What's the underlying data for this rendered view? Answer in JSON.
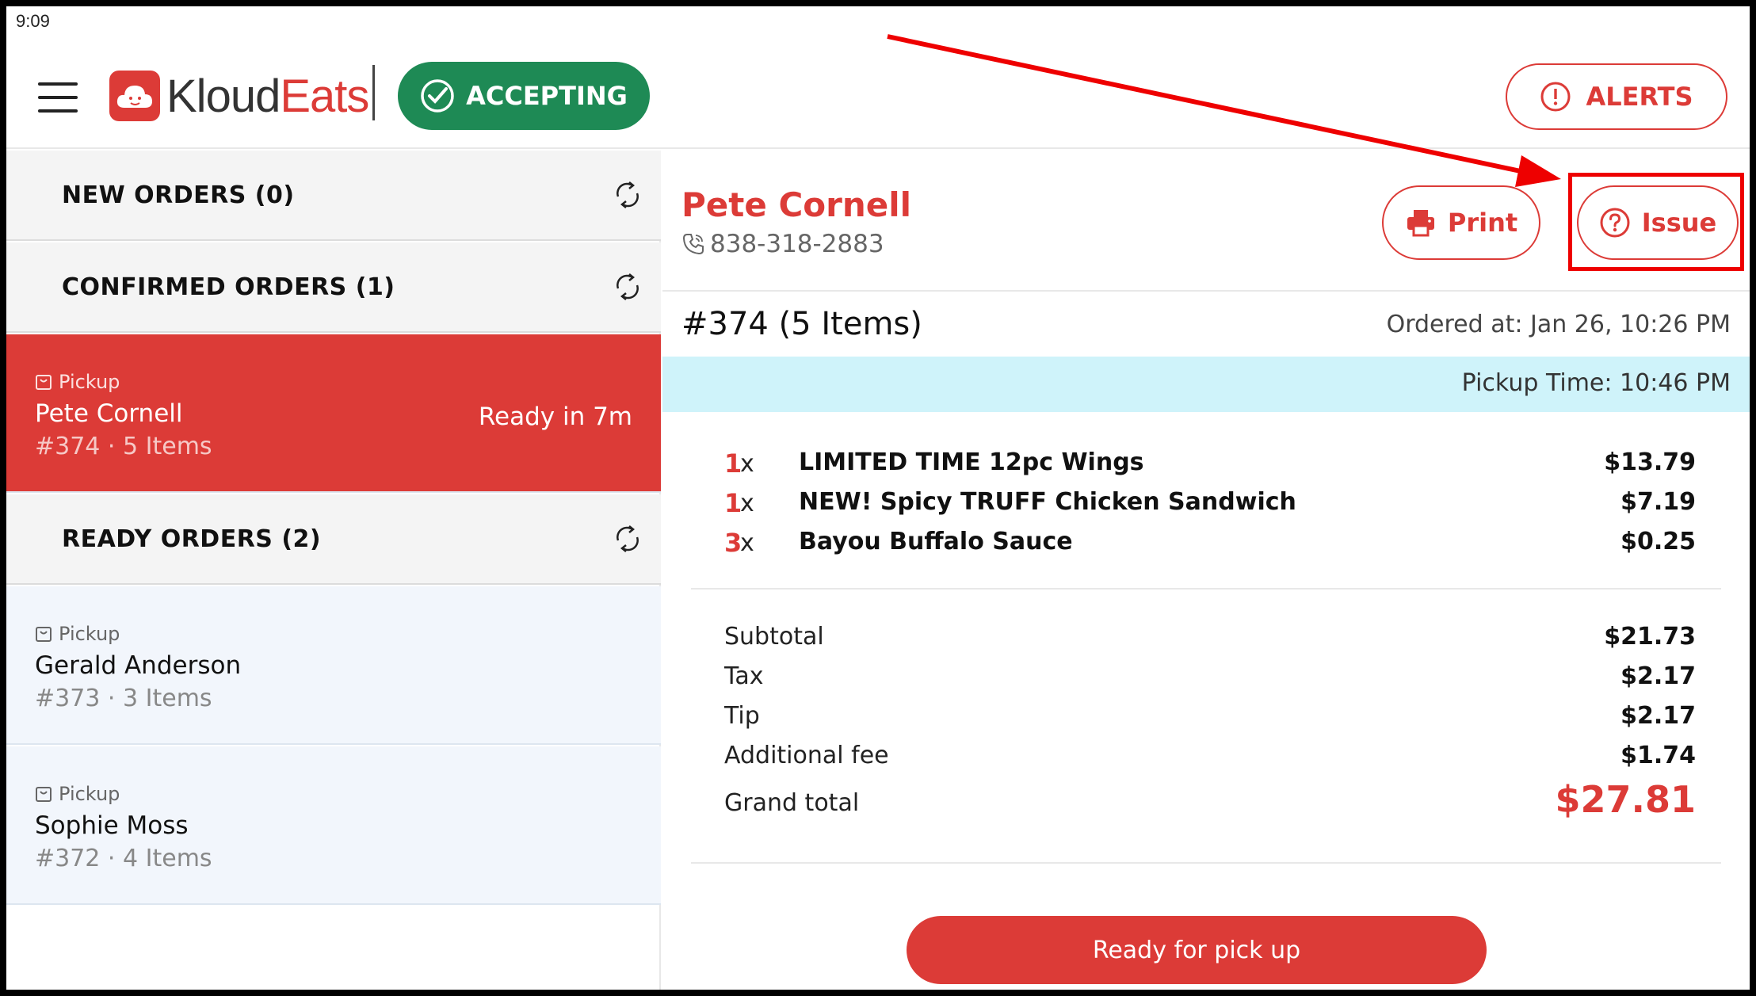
{
  "status_bar": {
    "time": "9:09"
  },
  "header": {
    "logo_text_a": "Kloud",
    "logo_text_b": "Eats",
    "accepting_label": "ACCEPTING",
    "alerts_label": "ALERTS"
  },
  "sidebar": {
    "new_orders": "NEW ORDERS (0)",
    "confirmed_orders": "CONFIRMED ORDERS (1)",
    "ready_orders": "READY ORDERS (2)",
    "confirmed": [
      {
        "type": "Pickup",
        "name": "Pete Cornell",
        "meta": "#374 · 5 Items",
        "ready_in": "Ready in 7m"
      }
    ],
    "ready": [
      {
        "type": "Pickup",
        "name": "Gerald Anderson",
        "meta": "#373 · 3 Items"
      },
      {
        "type": "Pickup",
        "name": "Sophie Moss",
        "meta": "#372 · 4 Items"
      }
    ]
  },
  "detail": {
    "customer_name": "Pete Cornell",
    "phone": "838-318-2883",
    "print_label": "Print",
    "issue_label": "Issue",
    "order_id": "#374 (5 Items)",
    "ordered_at": "Ordered at: Jan 26, 10:26 PM",
    "pickup_time": "Pickup Time: 10:46 PM",
    "items": [
      {
        "qty": "1",
        "x": "x",
        "name": "LIMITED TIME 12pc Wings",
        "price": "$13.79"
      },
      {
        "qty": "1",
        "x": "x",
        "name": "NEW! Spicy TRUFF Chicken Sandwich",
        "price": "$7.19"
      },
      {
        "qty": "3",
        "x": "x",
        "name": "Bayou Buffalo Sauce",
        "price": "$0.25"
      }
    ],
    "totals": [
      {
        "label": "Subtotal",
        "value": "$21.73"
      },
      {
        "label": "Tax",
        "value": "$2.17"
      },
      {
        "label": "Tip",
        "value": "$2.17"
      },
      {
        "label": "Additional fee",
        "value": "$1.74"
      }
    ],
    "grand_total_label": "Grand total",
    "grand_total_value": "$27.81",
    "ready_button": "Ready for pick up"
  },
  "colors": {
    "brand_red": "#dc3b37",
    "accepting_green": "#1e8a55",
    "pickup_bar": "#cff3fa",
    "annotation_red": "#ee0000"
  }
}
